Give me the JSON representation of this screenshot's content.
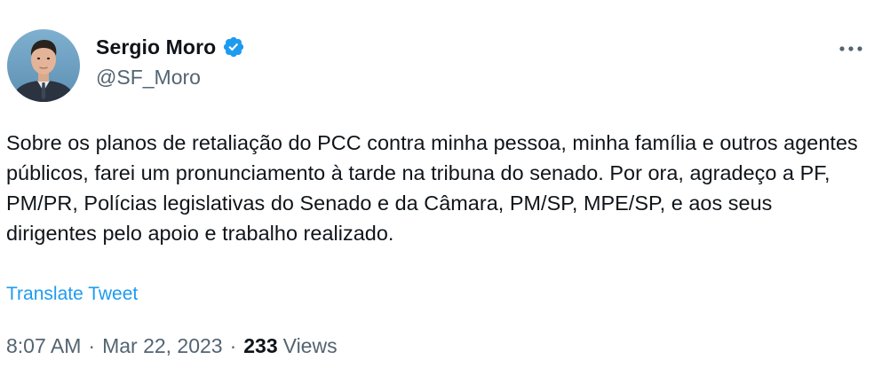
{
  "author": {
    "display_name": "Sergio Moro",
    "handle": "@SF_Moro",
    "verified": true
  },
  "icons": {
    "verified": "verified-badge-icon",
    "more": "more-options-icon",
    "avatar": "profile-avatar"
  },
  "tweet": {
    "text": "Sobre os planos de retaliação do PCC contra minha pessoa, minha família e outros agentes públicos, farei um pronunciamento à tarde na tribuna do senado. Por ora, agradeço a PF, PM/PR, Polícias legislativas do Senado e da Câmara, PM/SP, MPE/SP, e aos seus dirigentes pelo apoio e trabalho realizado.",
    "translate_label": "Translate Tweet",
    "time": "8:07 AM",
    "separator": "·",
    "date": "Mar 22, 2023",
    "views_count": "233",
    "views_label": "Views"
  },
  "colors": {
    "text_primary": "#0f1419",
    "text_secondary": "#536471",
    "accent": "#1d9bf0"
  }
}
